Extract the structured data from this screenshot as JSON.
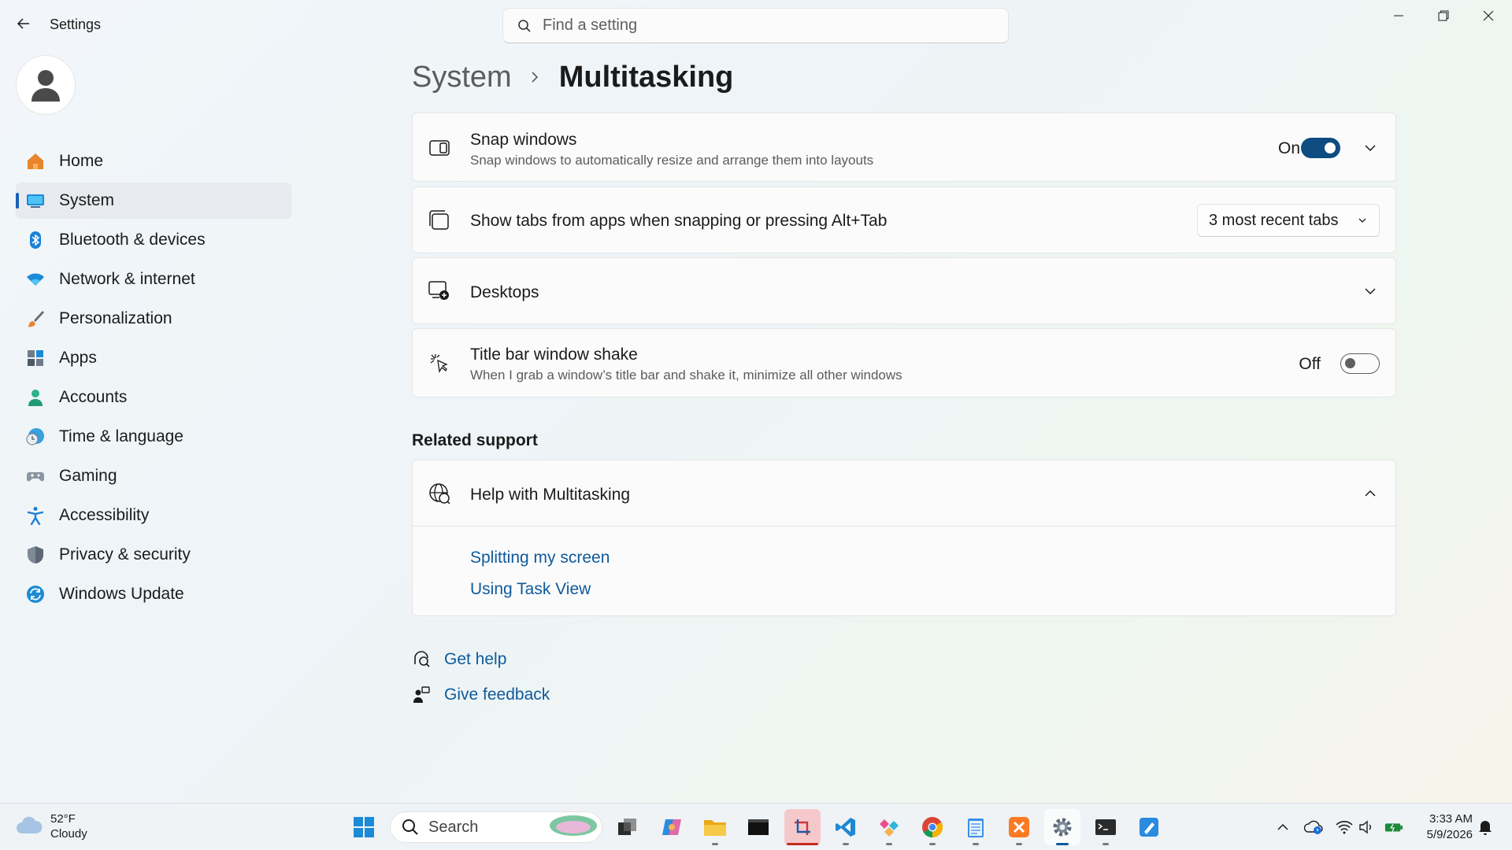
{
  "window": {
    "title": "Settings",
    "search_placeholder": "Find a setting"
  },
  "sidebar": {
    "items": [
      {
        "label": "Home",
        "icon": "home-icon"
      },
      {
        "label": "System",
        "icon": "system-icon",
        "active": true
      },
      {
        "label": "Bluetooth & devices",
        "icon": "bluetooth-icon"
      },
      {
        "label": "Network & internet",
        "icon": "wifi-icon"
      },
      {
        "label": "Personalization",
        "icon": "brush-icon"
      },
      {
        "label": "Apps",
        "icon": "apps-icon"
      },
      {
        "label": "Accounts",
        "icon": "accounts-icon"
      },
      {
        "label": "Time & language",
        "icon": "globe-clock-icon"
      },
      {
        "label": "Gaming",
        "icon": "gamepad-icon"
      },
      {
        "label": "Accessibility",
        "icon": "accessibility-icon"
      },
      {
        "label": "Privacy & security",
        "icon": "shield-icon"
      },
      {
        "label": "Windows Update",
        "icon": "update-icon"
      }
    ]
  },
  "breadcrumb": {
    "parent": "System",
    "current": "Multitasking"
  },
  "settings": {
    "snap": {
      "title": "Snap windows",
      "desc": "Snap windows to automatically resize and arrange them into layouts",
      "state": "On"
    },
    "tabs": {
      "title": "Show tabs from apps when snapping or pressing Alt+Tab",
      "value": "3 most recent tabs"
    },
    "desktops": {
      "title": "Desktops"
    },
    "shake": {
      "title": "Title bar window shake",
      "desc": "When I grab a window’s title bar and shake it, minimize all other windows",
      "state": "Off"
    }
  },
  "related": {
    "heading": "Related support",
    "help_title": "Help with Multitasking",
    "links": [
      "Splitting my screen",
      "Using Task View"
    ]
  },
  "footer": {
    "get_help": "Get help",
    "give_feedback": "Give feedback"
  },
  "taskbar": {
    "weather_temp": "52°F",
    "weather_desc": "Cloudy",
    "search_label": "Search",
    "time": "3:33 AM",
    "date": "5/9/2026"
  },
  "colors": {
    "accent": "#0f4c81",
    "link": "#0f5a9c"
  }
}
